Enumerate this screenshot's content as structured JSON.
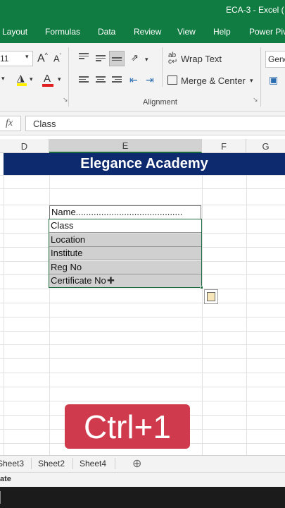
{
  "window": {
    "title": "ECA-3  -  Excel ("
  },
  "ribbon_tabs": [
    "Layout",
    "Formulas",
    "Data",
    "Review",
    "View",
    "Help",
    "Power Piv"
  ],
  "ribbon": {
    "font_size": "11",
    "wrap_text": "Wrap Text",
    "merge_center": "Merge & Center",
    "alignment_group": "Alignment",
    "number_format": "Gene"
  },
  "formula_bar": {
    "fx": "fx",
    "value": "Class"
  },
  "columns": [
    "D",
    "E",
    "F",
    "G"
  ],
  "sheet": {
    "banner": "Elegance Academy",
    "cells": [
      "Name..........................................",
      "Class",
      "Location",
      "Institute",
      "Reg No",
      "Certificate No"
    ]
  },
  "overlay": {
    "shortcut": "Ctrl+1"
  },
  "sheet_tabs": [
    "Sheet3",
    "Sheet2",
    "Sheet4"
  ],
  "add_sheet": "⊕",
  "status": {
    "text": "ate"
  },
  "colors": {
    "excel_green": "#107c41",
    "banner": "#0e2a6f",
    "shortcut_badge": "#cf3b4c"
  }
}
